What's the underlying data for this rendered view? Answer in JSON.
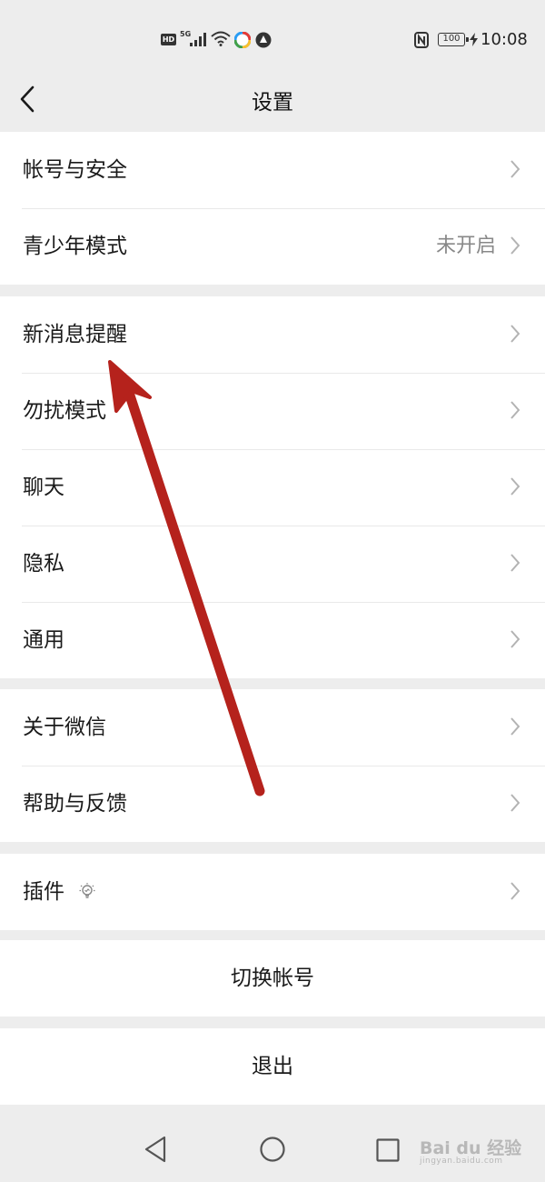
{
  "status_bar": {
    "hd_label": "HD",
    "network_label": "5G",
    "battery_level": "100",
    "time": "10:08",
    "icons": [
      "hd-icon",
      "signal-icon",
      "wifi-icon",
      "app-icon",
      "app-icon",
      "nfc-icon",
      "battery-icon",
      "charging-icon"
    ]
  },
  "nav": {
    "title": "设置",
    "back_icon": "chevron-left-icon"
  },
  "groups": [
    {
      "items": [
        {
          "label": "帐号与安全",
          "value": ""
        },
        {
          "label": "青少年模式",
          "value": "未开启"
        }
      ]
    },
    {
      "items": [
        {
          "label": "新消息提醒",
          "value": ""
        },
        {
          "label": "勿扰模式",
          "value": ""
        },
        {
          "label": "聊天",
          "value": ""
        },
        {
          "label": "隐私",
          "value": ""
        },
        {
          "label": "通用",
          "value": ""
        }
      ]
    },
    {
      "items": [
        {
          "label": "关于微信",
          "value": ""
        },
        {
          "label": "帮助与反馈",
          "value": ""
        }
      ]
    },
    {
      "items": [
        {
          "label": "插件",
          "value": "",
          "icon": "lightbulb-icon"
        }
      ]
    }
  ],
  "actions": {
    "switch_account": "切换帐号",
    "logout": "退出"
  },
  "watermark": {
    "text": "Bai du 经验",
    "sub": "jingyan.baidu.com"
  },
  "colors": {
    "background": "#ededed",
    "arrow": "#b5221c"
  }
}
